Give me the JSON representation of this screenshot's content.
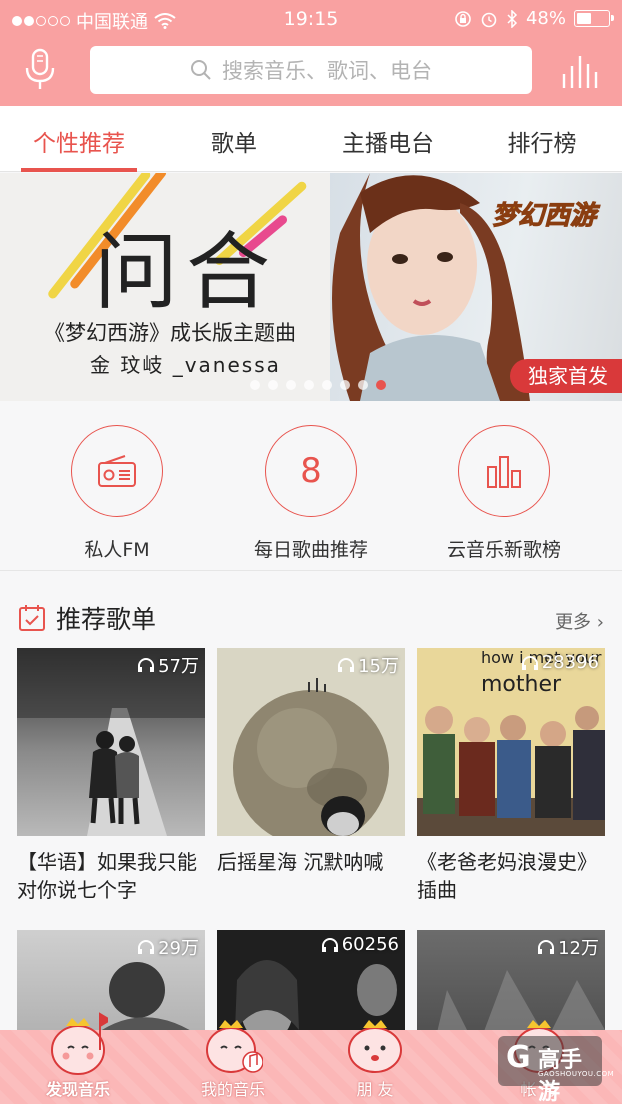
{
  "status_bar": {
    "carrier": "中国联通",
    "time": "19:15",
    "battery": "48%",
    "battery_level": 0.48
  },
  "header": {
    "search_placeholder": "搜索音乐、歌词、电台"
  },
  "tabs": [
    {
      "label": "个性推荐",
      "active": true
    },
    {
      "label": "歌单",
      "active": false
    },
    {
      "label": "主播电台",
      "active": false
    },
    {
      "label": "排行榜",
      "active": false
    }
  ],
  "banner": {
    "title": "问合",
    "subtitle": "《梦幻西游》成长版主题曲",
    "singer": "金 玟岐 _vanessa",
    "logo_text": "梦幻西游",
    "badge": "独家首发",
    "page_count": 8,
    "active_page": 7
  },
  "quick_links": [
    {
      "label": "私人FM",
      "icon": "radio-icon"
    },
    {
      "label": "每日歌曲推荐",
      "icon": "calendar-day-icon",
      "value": "8"
    },
    {
      "label": "云音乐新歌榜",
      "icon": "bar-chart-icon"
    }
  ],
  "recommended": {
    "title": "推荐歌单",
    "more": "更多",
    "playlists": [
      {
        "plays": "57万",
        "title": "【华语】如果我只能对你说七个字"
      },
      {
        "plays": "15万",
        "title": "后摇星海 沉默呐喊"
      },
      {
        "plays": "28396",
        "title": "《老爸老妈浪漫史》插曲",
        "cover_text_1": "how i met your",
        "cover_text_2": "mother"
      },
      {
        "plays": "29万",
        "title": ""
      },
      {
        "plays": "60256",
        "title": ""
      },
      {
        "plays": "12万",
        "title": ""
      }
    ]
  },
  "bottom_nav": [
    {
      "label": "发现音乐",
      "active": true
    },
    {
      "label": "我的音乐",
      "active": false
    },
    {
      "label": "朋 友",
      "active": false
    },
    {
      "label": "帐 号",
      "active": false
    }
  ],
  "watermark": {
    "glyph": "G",
    "title": "高手游",
    "site": "GAOSHOUYOU.COM"
  },
  "colors": {
    "brand_pink": "#f9a1a1",
    "accent_red": "#e8544e",
    "badge_red": "#d9393a"
  }
}
